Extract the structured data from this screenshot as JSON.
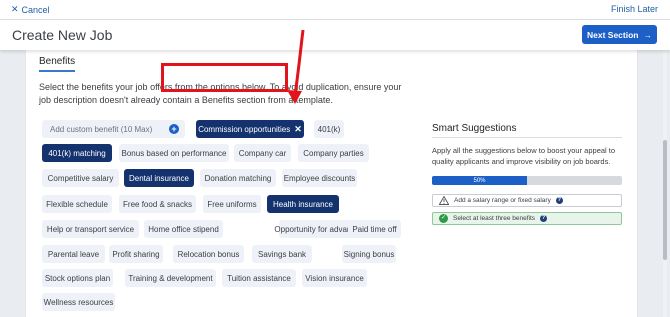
{
  "topbar": {
    "cancel_label": "Cancel",
    "finish_label": "Finish Later"
  },
  "header": {
    "title": "Create New Job",
    "next_label": "Next Section"
  },
  "benefits": {
    "heading": "Benefits",
    "description": "Select the benefits your job offers from the options below. To avoid duplication, ensure your job description doesn't already contain a Benefits section from a template.",
    "custom_placeholder": "Add custom benefit (10 Max)",
    "options": [
      {
        "label": "Commission opportunities",
        "selected": true,
        "removable": true
      },
      {
        "label": "401(k)",
        "selected": false
      },
      {
        "label": "401(k) matching",
        "selected": true
      },
      {
        "label": "Bonus based on performance",
        "selected": false
      },
      {
        "label": "Company car",
        "selected": false
      },
      {
        "label": "Company parties",
        "selected": false
      },
      {
        "label": "Competitive salary",
        "selected": false
      },
      {
        "label": "Dental insurance",
        "selected": true
      },
      {
        "label": "Donation matching",
        "selected": false
      },
      {
        "label": "Employee discounts",
        "selected": false
      },
      {
        "label": "Flexible schedule",
        "selected": false
      },
      {
        "label": "Free food & snacks",
        "selected": false
      },
      {
        "label": "Free uniforms",
        "selected": false
      },
      {
        "label": "Health insurance",
        "selected": true
      },
      {
        "label": "Help or transport service",
        "selected": false
      },
      {
        "label": "Home office stipend",
        "selected": false
      },
      {
        "label": "Opportunity for advancement",
        "selected": false
      },
      {
        "label": "Paid time off",
        "selected": false
      },
      {
        "label": "Parental leave",
        "selected": false
      },
      {
        "label": "Profit sharing",
        "selected": false
      },
      {
        "label": "Relocation bonus",
        "selected": false
      },
      {
        "label": "Savings bank",
        "selected": false
      },
      {
        "label": "Signing bonus",
        "selected": false
      },
      {
        "label": "Stock options plan",
        "selected": false
      },
      {
        "label": "Training & development",
        "selected": false
      },
      {
        "label": "Tuition assistance",
        "selected": false
      },
      {
        "label": "Vision insurance",
        "selected": false
      },
      {
        "label": "Wellness resources",
        "selected": false
      }
    ]
  },
  "smart": {
    "title": "Smart Suggestions",
    "description": "Apply all the suggestions below to boost your appeal to quality applicants and improve visibility on job boards.",
    "progress_label": "50%",
    "progress_fraction": 0.5,
    "suggestions": [
      {
        "label": "Add a salary range or fixed salary",
        "done": false
      },
      {
        "label": "Select at least three benefits",
        "done": true
      }
    ]
  },
  "colors": {
    "primary": "#1c5fc6",
    "selected_chip": "#14326e",
    "highlight": "#e0141a",
    "success": "#2e9a47"
  }
}
